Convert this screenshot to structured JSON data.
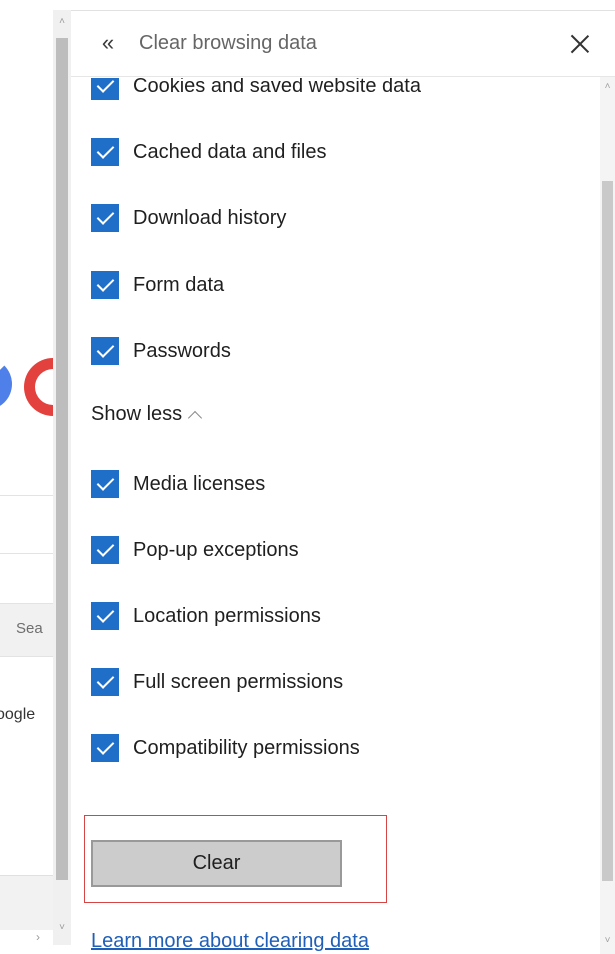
{
  "background_page": {
    "search_text": "Sea",
    "google_text": "oogle",
    "scroll_right_arrow": "›"
  },
  "pane": {
    "title": "Clear browsing data",
    "back_icon": "«",
    "options_top": [
      {
        "label": "Cookies and saved website data",
        "checked": true
      },
      {
        "label": "Cached data and files",
        "checked": true
      },
      {
        "label": "Download history",
        "checked": true
      },
      {
        "label": "Form data",
        "checked": true
      },
      {
        "label": "Passwords",
        "checked": true
      }
    ],
    "show_less_label": "Show less",
    "options_more": [
      {
        "label": "Media licenses",
        "checked": true
      },
      {
        "label": "Pop-up exceptions",
        "checked": true
      },
      {
        "label": "Location permissions",
        "checked": true
      },
      {
        "label": "Full screen permissions",
        "checked": true
      },
      {
        "label": "Compatibility permissions",
        "checked": true
      }
    ],
    "clear_button_label": "Clear",
    "learn_more_link": "Learn more about clearing data"
  },
  "scrollbars": {
    "up_arrow": "˄",
    "down_arrow": "˅"
  },
  "colors": {
    "checkbox_accent": "#1f6fc9",
    "link": "#1f5fb8",
    "highlight_frame": "#d64545"
  }
}
